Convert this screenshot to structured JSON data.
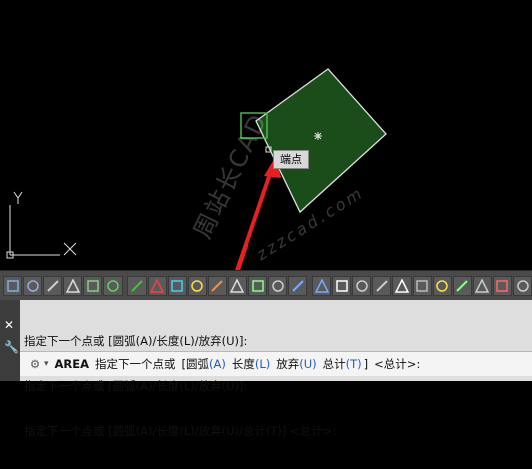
{
  "canvas": {
    "tooltip": "端点",
    "axis": {
      "y": "Y",
      "x": "X"
    },
    "watermark": {
      "line1": "周站长CAD",
      "line2": "zzzcad.com"
    },
    "colors": {
      "fill": "#1a4d1a",
      "outline": "#e0e0e0",
      "cursor_box": "#44bb44",
      "arrow": "#e82020"
    }
  },
  "toolbar": {
    "buttons": [
      "layout-icon",
      "save-icon",
      "link-icon",
      "grid-icon",
      "snap-icon",
      "layers-icon",
      "circle-icon",
      "region-icon",
      "move-icon",
      "array-icon",
      "point-icon",
      "dim-icon",
      "align-icon",
      "mirror-icon",
      "table-icon",
      "table2-icon",
      "measure-icon",
      "line-icon",
      "stretch-icon",
      "dashed-box-icon",
      "copy-icon",
      "pen-icon",
      "edit-icon",
      "offset-icon",
      "trim-icon",
      "arc-icon"
    ]
  },
  "command": {
    "history": [
      "指定下一个点或 [圆弧(A)/长度(L)/放弃(U)]:",
      "指定下一个点或 [圆弧(A)/长度(L)/放弃(U)]:",
      "指定下一个点或 [圆弧(A)/长度(L)/放弃(U)/总计(T)] <总计>:"
    ],
    "prompt": {
      "command": "AREA",
      "text": "指定下一个点或",
      "open": "[",
      "options": [
        {
          "label": "圆弧",
          "key": "(A)"
        },
        {
          "label": "长度",
          "key": "(L)"
        },
        {
          "label": "放弃",
          "key": "(U)"
        },
        {
          "label": "总计",
          "key": "(T)"
        }
      ],
      "close": "]",
      "default": "<总计>:"
    },
    "close_symbol": "✕",
    "tool_symbol": "🔧",
    "gear_symbol": "⚙",
    "caret_symbol": "▾"
  }
}
